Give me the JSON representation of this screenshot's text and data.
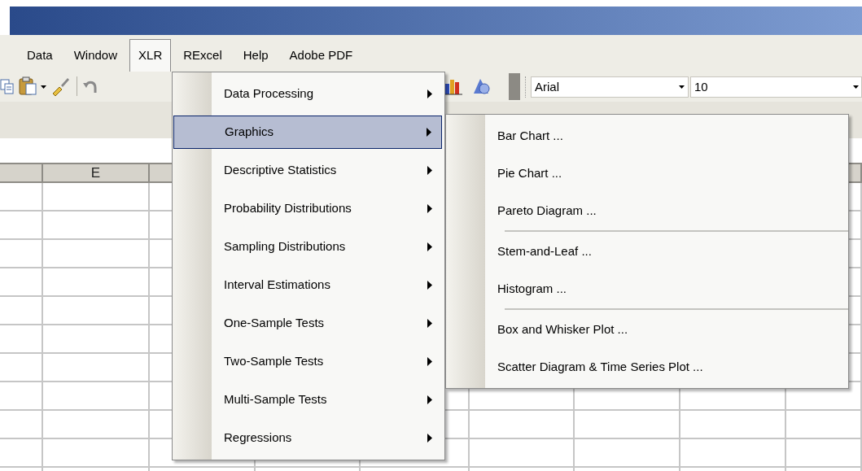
{
  "menu_bar": [
    {
      "label": "Data",
      "selected": false
    },
    {
      "label": "Window",
      "selected": false
    },
    {
      "label": "XLR",
      "selected": true
    },
    {
      "label": "RExcel",
      "selected": false
    },
    {
      "label": "Help",
      "selected": false
    },
    {
      "label": "Adobe PDF",
      "selected": false
    }
  ],
  "toolbar": {
    "font": "Arial",
    "font_size": "10"
  },
  "sheet": {
    "column_header": "E"
  },
  "menu": {
    "items": [
      {
        "label": "Data Processing",
        "selected": false
      },
      {
        "label": "Graphics",
        "selected": true
      },
      {
        "label": "Descriptive Statistics",
        "selected": false
      },
      {
        "label": "Probability Distributions",
        "selected": false
      },
      {
        "label": "Sampling Distributions",
        "selected": false
      },
      {
        "label": "Interval Estimations",
        "selected": false
      },
      {
        "label": "One-Sample Tests",
        "selected": false
      },
      {
        "label": "Two-Sample Tests",
        "selected": false
      },
      {
        "label": "Multi-Sample Tests",
        "selected": false
      },
      {
        "label": "Regressions",
        "selected": false
      }
    ]
  },
  "submenu": {
    "groups": [
      [
        "Bar Chart ...",
        "Pie Chart ...",
        "Pareto Diagram ..."
      ],
      [
        "Stem-and-Leaf ...",
        "Histogram ..."
      ],
      [
        "Box and Whisker Plot ...",
        "Scatter Diagram & Time Series Plot ..."
      ]
    ]
  }
}
